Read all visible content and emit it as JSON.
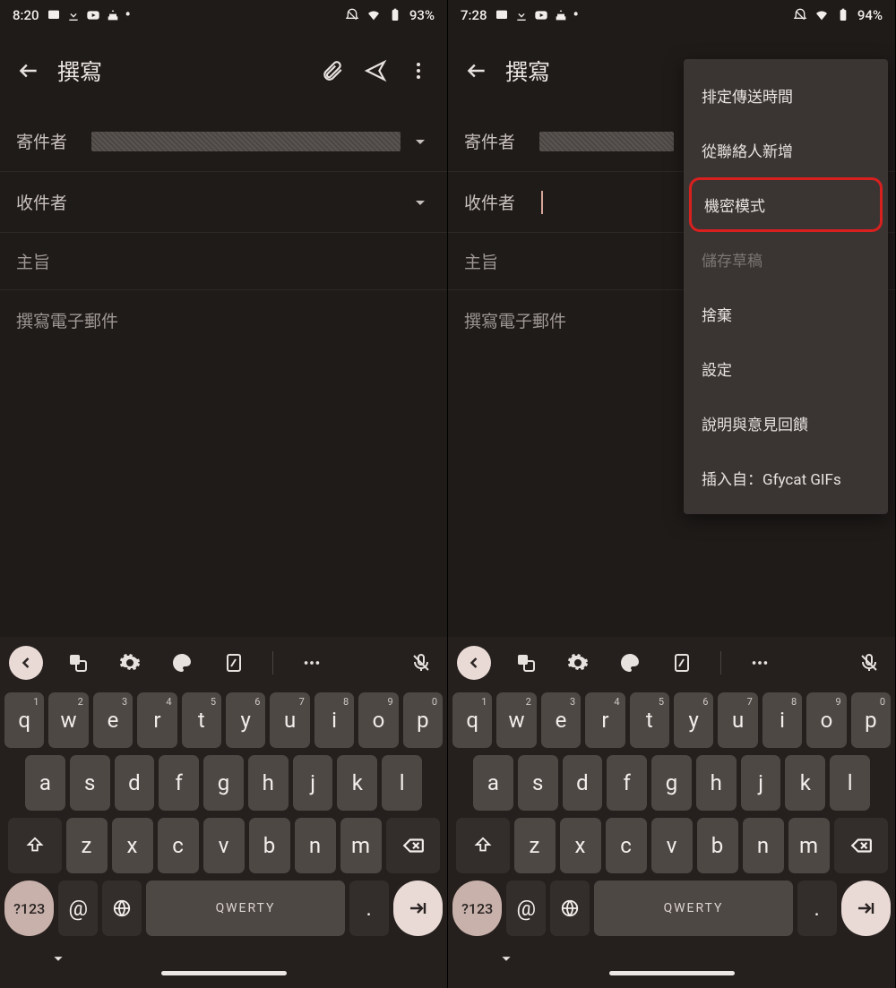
{
  "left": {
    "status": {
      "time": "8:20",
      "battery": "93%"
    },
    "header": {
      "title": "撰寫"
    },
    "fields": {
      "from_label": "寄件者",
      "to_label": "收件者",
      "subject_placeholder": "主旨",
      "body_placeholder": "撰寫電子郵件"
    }
  },
  "right": {
    "status": {
      "time": "7:28",
      "battery": "94%"
    },
    "header": {
      "title": "撰寫"
    },
    "fields": {
      "from_label": "寄件者",
      "to_label": "收件者",
      "subject_placeholder": "主旨",
      "body_placeholder": "撰寫電子郵件"
    },
    "menu": {
      "items": [
        {
          "label": "排定傳送時間",
          "disabled": false,
          "highlight": false
        },
        {
          "label": "從聯絡人新增",
          "disabled": false,
          "highlight": false
        },
        {
          "label": "機密模式",
          "disabled": false,
          "highlight": true
        },
        {
          "label": "儲存草稿",
          "disabled": true,
          "highlight": false
        },
        {
          "label": "捨棄",
          "disabled": false,
          "highlight": false
        },
        {
          "label": "設定",
          "disabled": false,
          "highlight": false
        },
        {
          "label": "說明與意見回饋",
          "disabled": false,
          "highlight": false
        },
        {
          "label": "插入自：Gfycat GIFs",
          "disabled": false,
          "highlight": false
        }
      ]
    }
  },
  "keyboard": {
    "row1": [
      {
        "k": "q",
        "n": "1"
      },
      {
        "k": "w",
        "n": "2"
      },
      {
        "k": "e",
        "n": "3"
      },
      {
        "k": "r",
        "n": "4"
      },
      {
        "k": "t",
        "n": "5"
      },
      {
        "k": "y",
        "n": "6"
      },
      {
        "k": "u",
        "n": "7"
      },
      {
        "k": "i",
        "n": "8"
      },
      {
        "k": "o",
        "n": "9"
      },
      {
        "k": "p",
        "n": "0"
      }
    ],
    "row2": [
      "a",
      "s",
      "d",
      "f",
      "g",
      "h",
      "j",
      "k",
      "l"
    ],
    "row3": [
      "z",
      "x",
      "c",
      "v",
      "b",
      "n",
      "m"
    ],
    "switch_label": "?123",
    "space_label": "QWERTY",
    "at_label": "@",
    "period_label": "."
  }
}
